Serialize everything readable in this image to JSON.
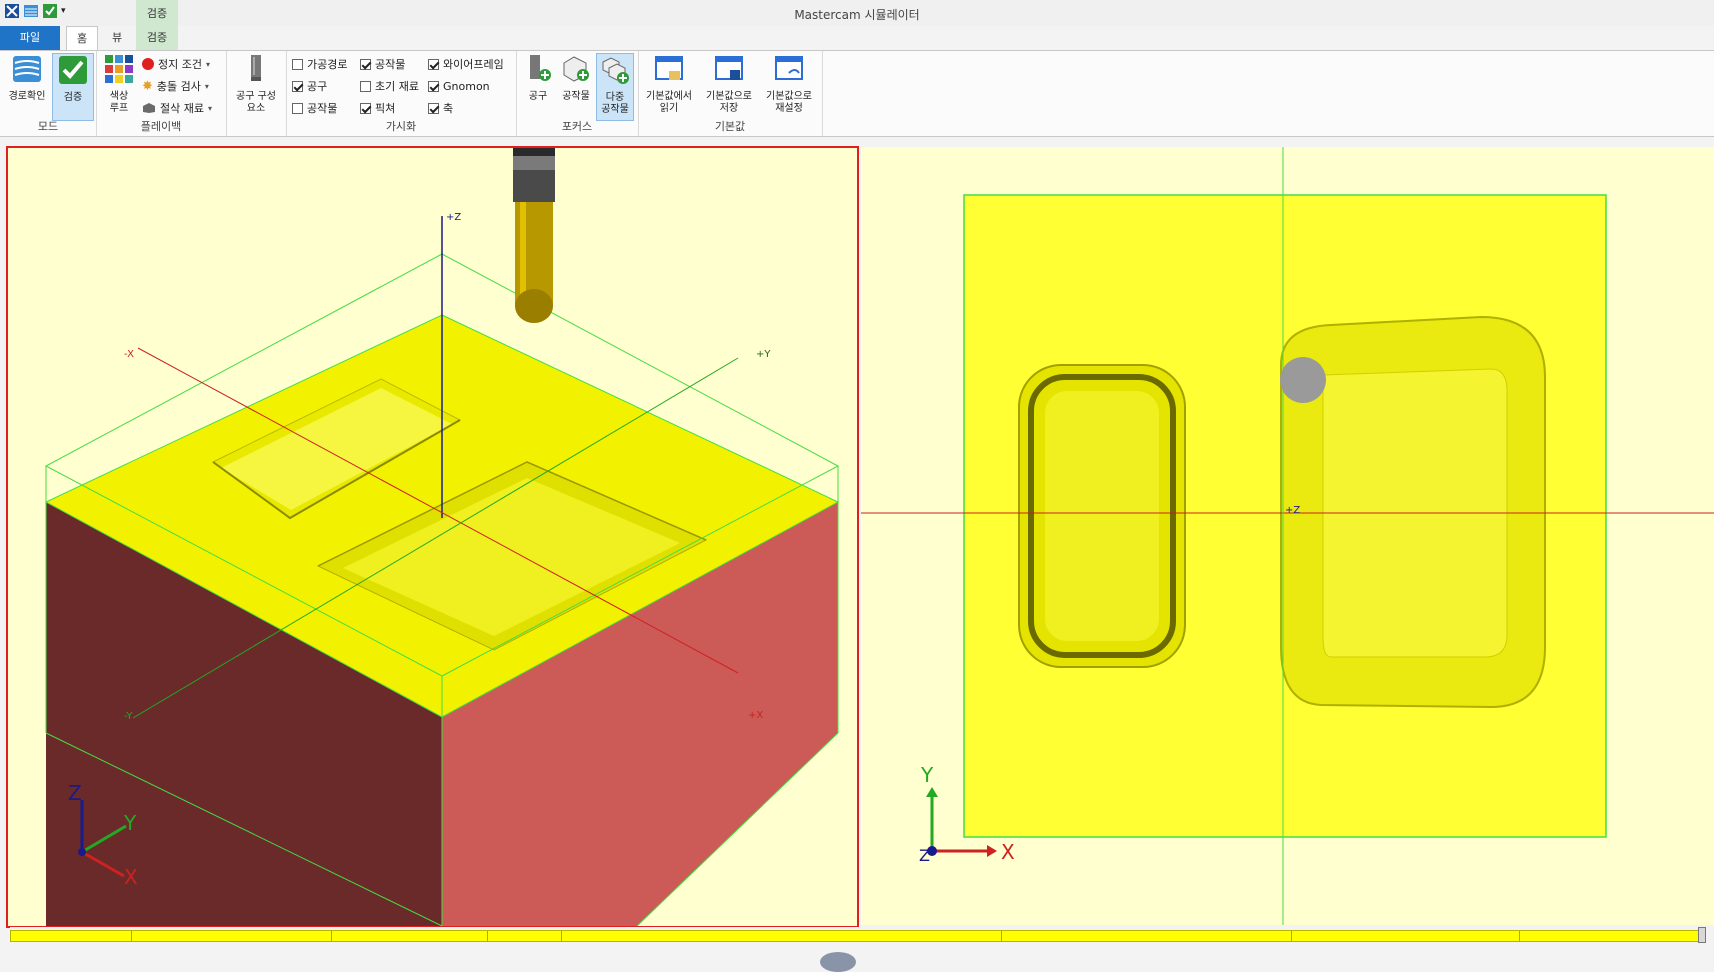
{
  "app": {
    "title": "Mastercam 시뮬레이터"
  },
  "context_tab": {
    "label": "검증"
  },
  "tabs": {
    "file": "파일",
    "home": "홈",
    "view": "뷰",
    "verify": "검증"
  },
  "ribbon": {
    "mode": {
      "label": "모드",
      "backplot": "경로확인",
      "verify": "검증"
    },
    "playback": {
      "label": "플레이백",
      "color_loop": "색상\n루프",
      "stop_conditions": "정지 조건",
      "collision_check": "충돌 검사",
      "cut_stock": "절삭 재료"
    },
    "tool_parts": {
      "label": "공구 구성\n요소"
    },
    "visibility": {
      "label": "가시화",
      "items": [
        {
          "label": "가공경로",
          "checked": false
        },
        {
          "label": "공구",
          "checked": true
        },
        {
          "label": "공작물",
          "checked": false
        },
        {
          "label": "공작물",
          "checked": true
        },
        {
          "label": "초기 재료",
          "checked": false
        },
        {
          "label": "픽쳐",
          "checked": true
        },
        {
          "label": "와이어프레임",
          "checked": true
        },
        {
          "label": "Gnomon",
          "checked": true
        },
        {
          "label": "축",
          "checked": true
        }
      ]
    },
    "focus": {
      "label": "포커스",
      "tool": "공구",
      "workpiece": "공작물",
      "multi_workpiece": "다중\n공작물"
    },
    "defaults": {
      "label": "기본값",
      "load": "기본값에서\n읽기",
      "save": "기본값으로\n저장",
      "reset": "기본값으로\n재설정"
    }
  },
  "viewport_left": {
    "axis_labels": {
      "plus_z": "+Z",
      "minus_x": "-X",
      "plus_y": "+Y",
      "plus_x": "+X",
      "minus_y": "-Y"
    },
    "gnomon": {
      "z": "Z",
      "y": "Y",
      "x": "X"
    }
  },
  "viewport_right": {
    "axis_label_z": "+Z",
    "gnomon": {
      "y": "Y",
      "x": "X",
      "z": "Z"
    }
  },
  "colors": {
    "stock_top": "#f2f200",
    "stock_left": "#6b2a2a",
    "stock_right": "#cc5a57",
    "background": "#ffffd0",
    "bounding_box": "#44dd44",
    "active_border": "#e02020",
    "axis_x": "#cc2222",
    "axis_y": "#22aa22",
    "axis_z": "#1a1a8a"
  },
  "timeline": {
    "progress": 1.0
  }
}
